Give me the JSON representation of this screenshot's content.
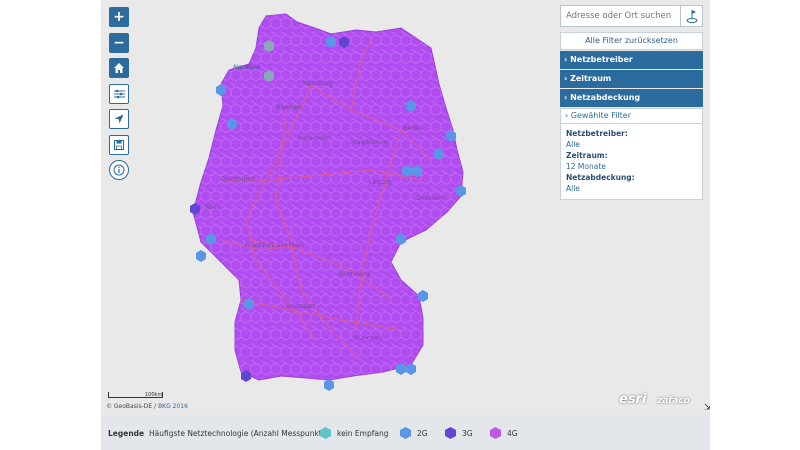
{
  "map": {
    "cities": [
      "Nordsee",
      "Hamburg",
      "Bremen",
      "Berlin",
      "Hannover",
      "Magdeburg",
      "Dortmund",
      "Leipzig",
      "Köln",
      "Dresden",
      "Frankfurt am Main",
      "Nürnberg",
      "Stuttgart",
      "München"
    ],
    "colors": {
      "kein_empfang": "#5ec4c8",
      "g2": "#5a95e6",
      "g3": "#6146d6",
      "g4": "#bb5ae6",
      "fill": "#b04cf0",
      "road": "#de5a8a"
    }
  },
  "search": {
    "placeholder": "Adresse oder Ort suchen"
  },
  "panel": {
    "reset": "Alle Filter zurücksetzen",
    "sections": [
      "› Netzbetreiber",
      "› Zeitraum",
      "› Netzabdeckung"
    ],
    "selected_header": "› Gewählte Filter",
    "selected": [
      {
        "key": "Netzbetreiber:",
        "value": "Alle"
      },
      {
        "key": "Zeitraum:",
        "value": "12 Monate"
      },
      {
        "key": "Netzabdeckung:",
        "value": "Alle"
      }
    ]
  },
  "tools": {
    "zoom_in": "+",
    "zoom_out": "−"
  },
  "scale": "100km",
  "copyright": {
    "text": "© GeoBasis-DE /",
    "link": "BKG 2016"
  },
  "logos": {
    "esri": "esri",
    "zafaco": "zafaco"
  },
  "legend": {
    "title": "Legende",
    "subtitle": "Häufigste Netztechnologie (Anzahl Messpunkte)",
    "items": [
      "kein Empfang",
      "2G",
      "3G",
      "4G"
    ]
  }
}
